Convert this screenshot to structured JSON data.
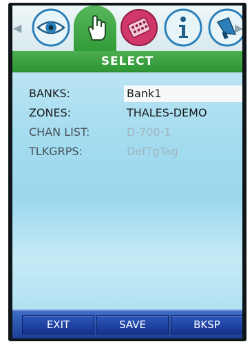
{
  "title": "SELECT",
  "icon_tabs": [
    {
      "name": "eye-icon",
      "color": "#2a7fb8"
    },
    {
      "name": "hand-icon",
      "color": "#ffffff",
      "selected": true
    },
    {
      "name": "keypad-icon",
      "color": "#c2285a"
    },
    {
      "name": "info-icon",
      "color": "#2a7fb8"
    },
    {
      "name": "megaphone-icon",
      "color": "#2a7fb8"
    }
  ],
  "nav": {
    "left_arrow": "◀",
    "right_arrow": "▶"
  },
  "fields": [
    {
      "label": "BANKS:",
      "value": "Bank1",
      "selected": true
    },
    {
      "label": "ZONES:",
      "value": "THALES-DEMO"
    },
    {
      "label": "CHAN LIST:",
      "value": "D-700-1",
      "dim": true
    },
    {
      "label": "TLKGRPS:",
      "value": "DefTgTag",
      "dim": true
    }
  ],
  "softkeys": {
    "exit": "EXIT",
    "save": "SAVE",
    "bksp": "BKSP"
  },
  "colors": {
    "title_bar": "#3ea443",
    "softkey_bar": "#1d3f94",
    "screen_bg": "#a4dcef"
  }
}
